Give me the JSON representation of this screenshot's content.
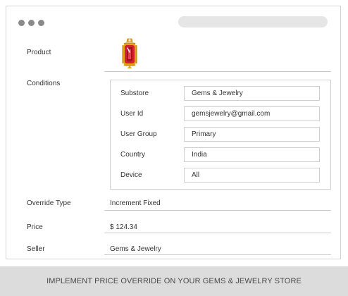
{
  "form": {
    "product_label": "Product",
    "conditions_label": "Conditions",
    "override_type_label": "Override Type",
    "override_type_value": "Increment Fixed",
    "price_label": "Price",
    "price_value": "$ 124.34",
    "seller_label": "Seller",
    "seller_value": "Gems & Jewelry"
  },
  "conditions": {
    "substore_label": "Substore",
    "substore_value": "Gems & Jewelry",
    "user_id_label": "User Id",
    "user_id_value": "gemsjewelry@gmail.com",
    "user_group_label": "User Group",
    "user_group_value": "Primary",
    "country_label": "Country",
    "country_value": "India",
    "device_label": "Device",
    "device_value": "All"
  },
  "footer": {
    "caption": "IMPLEMENT PRICE OVERRIDE ON YOUR GEMS & JEWELRY STORE"
  },
  "colors": {
    "window_border": "#d4d4d4",
    "dots": "#8a8a8a",
    "footer_bg": "#dcdcdc",
    "gem_red": "#d41f2f",
    "gold": "#e3a21a"
  },
  "icons": {
    "product": "ruby-pendant-icon"
  }
}
